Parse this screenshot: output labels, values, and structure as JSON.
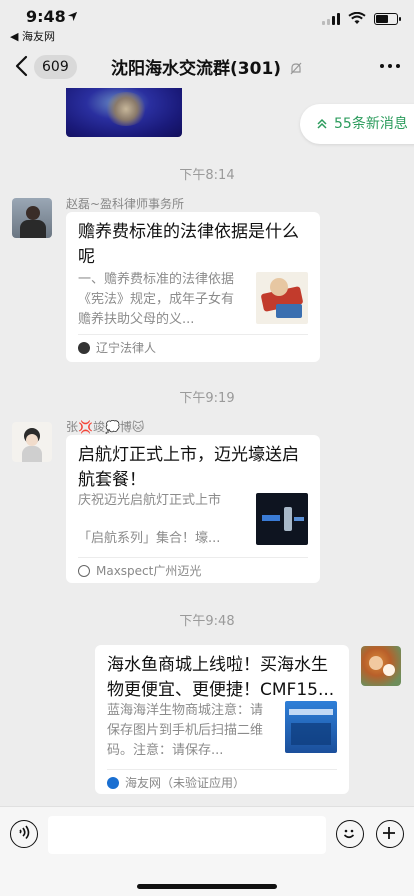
{
  "status": {
    "time": "9:48",
    "back_app": "◀ 海友网"
  },
  "nav": {
    "back_count": "609",
    "title": "沈阳海水交流群(301)"
  },
  "new_messages": "55条新消息",
  "timestamps": [
    "下午8:14",
    "下午9:19",
    "下午9:48"
  ],
  "messages": [
    {
      "sender": "赵磊~盈科律师事务所",
      "title": "赡养费标准的法律依据是什么呢",
      "desc": "一、赡养费标准的法律依据《宪法》规定，成年子女有赡养扶助父母的义...",
      "source": "辽宁法律人"
    },
    {
      "sender": "张💢竣💭博🐱",
      "title": "启航灯正式上市，迈光壕送启航套餐！",
      "desc_line1": "庆祝迈光启航灯正式上市",
      "desc_line2": "「启航系列」集合！壕...",
      "source": "Maxspect广州迈光"
    },
    {
      "sender": "",
      "title": "海水鱼商城上线啦！买海水生物更便宜、更便捷！CMF15...",
      "desc": "蓝海海洋生物商城注意：请保存图片到手机后扫描二维码。注意：请保存...",
      "source": "海友网（未验证应用）"
    }
  ],
  "icons": {
    "voice": "voice-icon",
    "emoji": "emoji-icon",
    "plus": "plus-icon",
    "more": "more-icon",
    "back": "chevron-left-icon",
    "mute": "mute-bell-icon"
  },
  "colors": {
    "accent": "#2c9c5d",
    "background": "#ededed"
  }
}
